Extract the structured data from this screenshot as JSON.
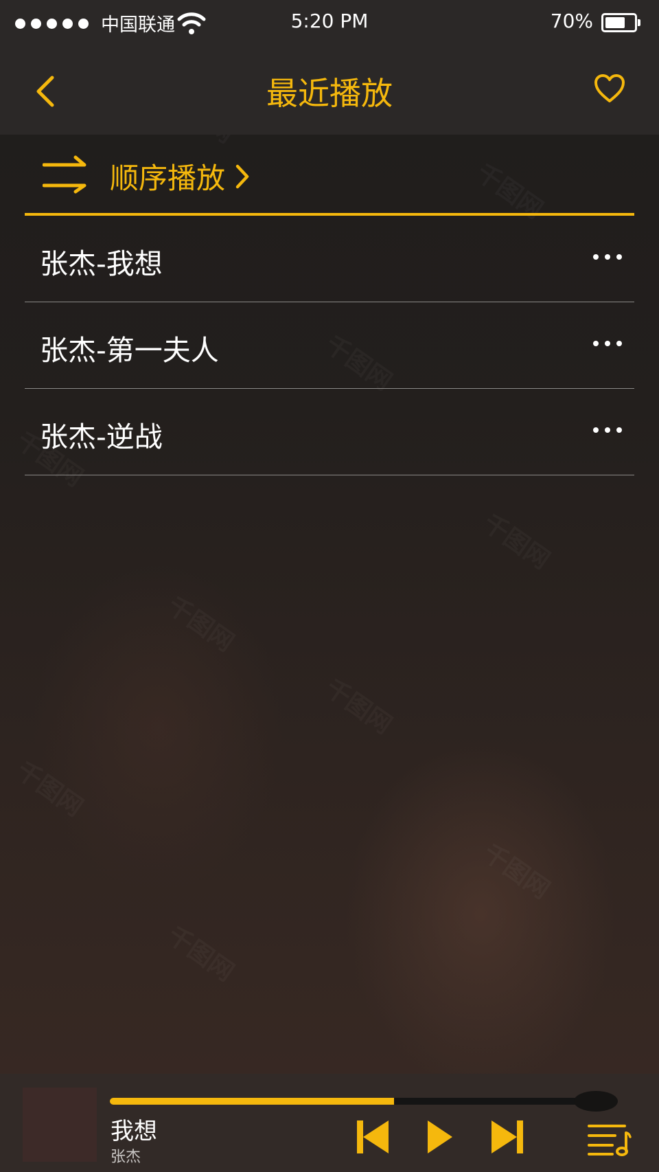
{
  "status_bar": {
    "carrier": "中国联通",
    "time": "5:20 PM",
    "battery_percent": "70%",
    "battery_level": 0.7
  },
  "nav": {
    "title": "最近播放"
  },
  "play_mode": {
    "label": "顺序播放"
  },
  "songs": [
    {
      "name": "张杰-我想"
    },
    {
      "name": "张杰-第一夫人"
    },
    {
      "name": "张杰-逆战"
    }
  ],
  "player": {
    "title": "我想",
    "artist": "张杰",
    "progress": 0.6
  },
  "colors": {
    "accent": "#f5b80d",
    "bar": "#2b2827",
    "text": "#ffffff"
  }
}
